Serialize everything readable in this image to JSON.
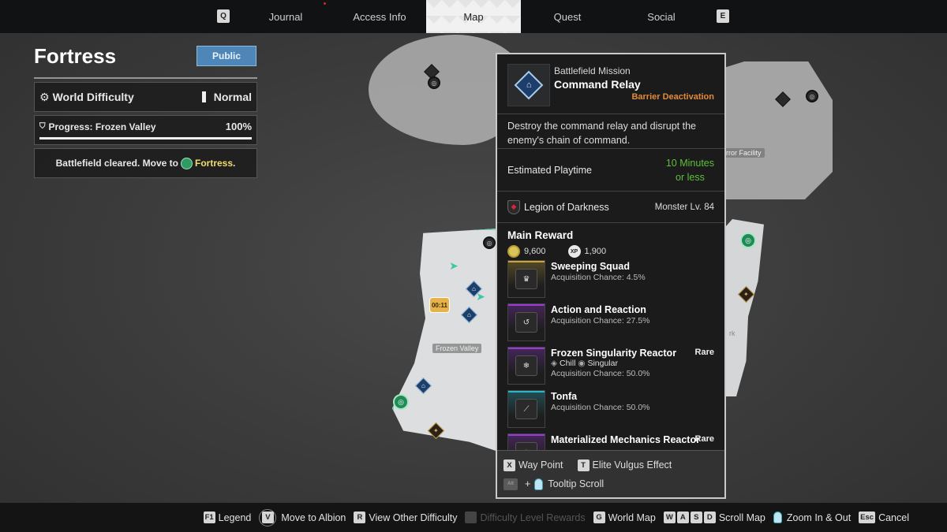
{
  "nav": {
    "left_key": "Q",
    "right_key": "E",
    "tabs": [
      {
        "label": "Journal",
        "active": false
      },
      {
        "label": "Access Info",
        "active": false
      },
      {
        "label": "Map",
        "active": true
      },
      {
        "label": "Quest",
        "active": false
      },
      {
        "label": "Social",
        "active": false
      }
    ]
  },
  "location": {
    "title": "Fortress",
    "visibility_button": "Public",
    "world_difficulty_label": "World Difficulty",
    "world_difficulty_value": "Normal",
    "progress_label": "Progress: Frozen Valley",
    "progress_value": "100%",
    "progress_fraction": 1.0,
    "status_prefix": "Battlefield cleared. Move to",
    "status_link": "Fortress",
    "status_suffix": "."
  },
  "map": {
    "labels": {
      "frozen_valley": "Frozen Valley",
      "facility": "rror Facility",
      "right_partial": "rk"
    },
    "timer_badge": "00:11"
  },
  "mission": {
    "type": "Battlefield Mission",
    "name": "Command Relay",
    "subtype": "Barrier Deactivation",
    "description": "Destroy the command relay and disrupt the enemy's chain of command.",
    "playtime_label": "Estimated Playtime",
    "playtime_value_line1": "10 Minutes",
    "playtime_value_line2": "or less",
    "faction": "Legion of Darkness",
    "monster_level": "Monster Lv. 84",
    "reward_title": "Main Reward",
    "gold": "9,600",
    "xp": "1,900",
    "xp_icon_text": "XP",
    "rewards": [
      {
        "name": "Sweeping Squad",
        "chance": "Acquisition Chance: 4.5%",
        "rarity": "",
        "accent": "#c9a53a",
        "tags": []
      },
      {
        "name": "Action and Reaction",
        "chance": "Acquisition Chance: 27.5%",
        "rarity": "",
        "accent": "#9a3ad6",
        "tags": []
      },
      {
        "name": "Frozen Singularity Reactor",
        "chance": "Acquisition Chance: 50.0%",
        "rarity": "Rare",
        "accent": "#9a3ad6",
        "tags": [
          "Chill",
          "Singular"
        ]
      },
      {
        "name": "Tonfa",
        "chance": "Acquisition Chance: 50.0%",
        "rarity": "",
        "accent": "#2bb6c8",
        "tags": []
      },
      {
        "name": "Materialized Mechanics Reactor",
        "chance": "",
        "rarity": "Rare",
        "accent": "#9a3ad6",
        "tags": []
      }
    ],
    "footer": {
      "waypoint_key": "X",
      "waypoint_label": "Way Point",
      "elite_key": "T",
      "elite_label": "Elite Vulgus Effect",
      "scroll_key": "Alt",
      "scroll_plus": "+",
      "scroll_label": "Tooltip Scroll"
    }
  },
  "bottom_bar": [
    {
      "keys": [
        "F1"
      ],
      "label": "Legend",
      "enabled": true
    },
    {
      "keys": [
        "V"
      ],
      "label": "Move to Albion",
      "enabled": true,
      "circle": true
    },
    {
      "keys": [
        "R"
      ],
      "label": "View Other Difficulty",
      "enabled": true
    },
    {
      "keys": [
        ""
      ],
      "label": "Difficulty Level Rewards",
      "enabled": false
    },
    {
      "keys": [
        "G"
      ],
      "label": "World Map",
      "enabled": true
    },
    {
      "keys": [
        "W",
        "A",
        "S",
        "D"
      ],
      "label": "Scroll Map",
      "enabled": true
    },
    {
      "keys": [],
      "label": "Zoom In & Out",
      "enabled": true,
      "mouse": true
    },
    {
      "keys": [
        "Esc"
      ],
      "label": "Cancel",
      "enabled": true
    }
  ],
  "colors": {
    "accent_blue": "#4f86b8",
    "fortress_yellow": "#f1de6a",
    "subtype_orange": "#e38a3a",
    "playtime_green": "#5fbf3a"
  }
}
